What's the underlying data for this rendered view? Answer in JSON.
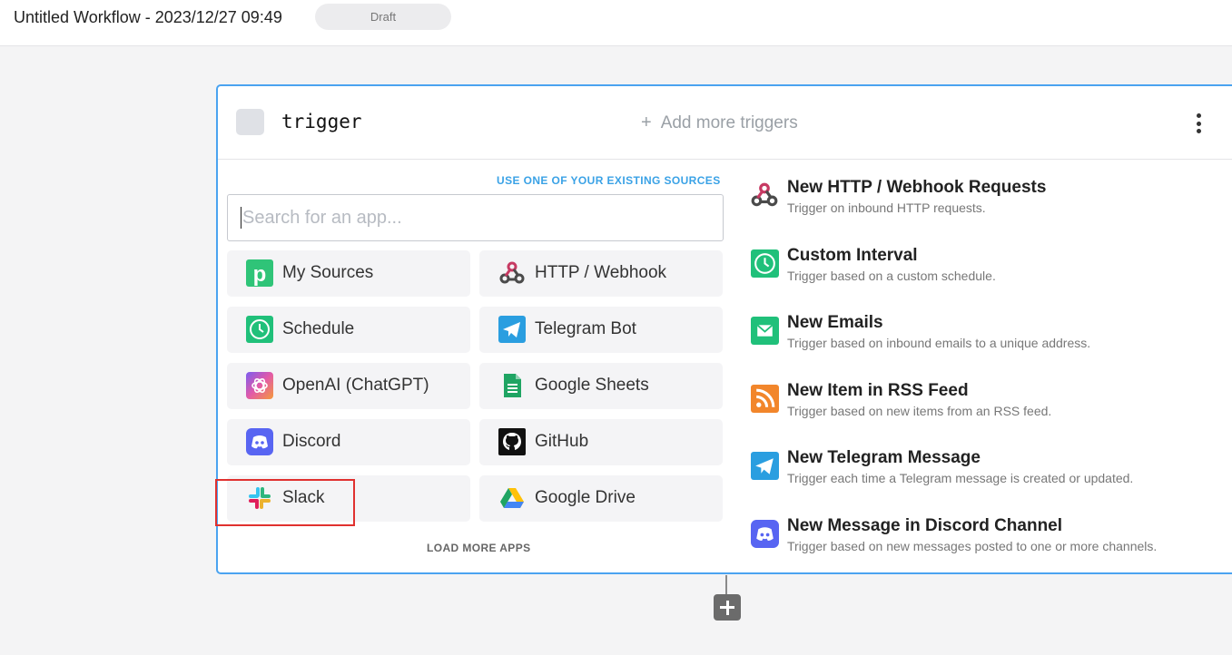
{
  "header": {
    "title": "Untitled Workflow - 2023/12/27 09:49",
    "status": "Draft"
  },
  "step": {
    "name": "trigger",
    "add_more_label": "Add more triggers",
    "add_more_plus": "+"
  },
  "apps": {
    "existing_sources_link": "USE ONE OF YOUR EXISTING SOURCES",
    "search_placeholder": "Search for an app...",
    "items": [
      {
        "label": "My Sources",
        "icon": "pipedream-p-icon"
      },
      {
        "label": "HTTP / Webhook",
        "icon": "webhook-icon"
      },
      {
        "label": "Schedule",
        "icon": "clock-icon"
      },
      {
        "label": "Telegram Bot",
        "icon": "telegram-icon"
      },
      {
        "label": "OpenAI (ChatGPT)",
        "icon": "openai-icon"
      },
      {
        "label": "Google Sheets",
        "icon": "google-sheets-icon"
      },
      {
        "label": "Discord",
        "icon": "discord-icon"
      },
      {
        "label": "GitHub",
        "icon": "github-icon"
      },
      {
        "label": "Slack",
        "icon": "slack-icon"
      },
      {
        "label": "Google Drive",
        "icon": "google-drive-icon"
      }
    ],
    "load_more_label": "LOAD MORE APPS"
  },
  "triggers": [
    {
      "title": "New HTTP / Webhook Requests",
      "desc": "Trigger on inbound HTTP requests.",
      "icon": "webhook-icon"
    },
    {
      "title": "Custom Interval",
      "desc": "Trigger based on a custom schedule.",
      "icon": "clock-icon"
    },
    {
      "title": "New Emails",
      "desc": "Trigger based on inbound emails to a unique address.",
      "icon": "email-icon"
    },
    {
      "title": "New Item in RSS Feed",
      "desc": "Trigger based on new items from an RSS feed.",
      "icon": "rss-icon"
    },
    {
      "title": "New Telegram Message",
      "desc": "Trigger each time a Telegram message is created or updated.",
      "icon": "telegram-icon"
    },
    {
      "title": "New Message in Discord Channel",
      "desc": "Trigger based on new messages posted to one or more channels.",
      "icon": "discord-icon"
    }
  ],
  "colors": {
    "accent": "#3aa2e6",
    "card_border": "#4aa3f0",
    "highlight": "#e0312f",
    "schedule_green": "#20c07a",
    "telegram_blue": "#2a9ee0",
    "discord": "#5865f2",
    "rss_orange": "#f2862b"
  }
}
